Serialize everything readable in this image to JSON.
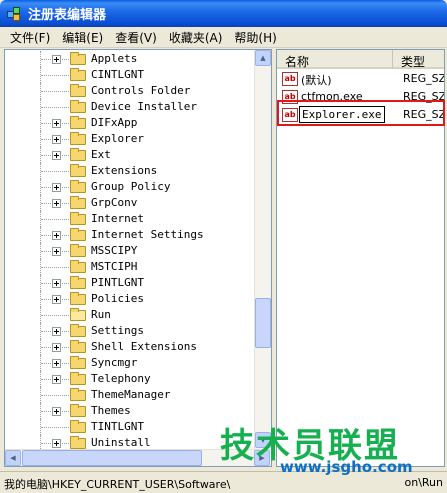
{
  "window": {
    "title": "注册表编辑器"
  },
  "menu": [
    {
      "label": "文件(F)"
    },
    {
      "label": "编辑(E)"
    },
    {
      "label": "查看(V)"
    },
    {
      "label": "收藏夹(A)"
    },
    {
      "label": "帮助(H)"
    }
  ],
  "tree": [
    {
      "label": "Applets",
      "expandable": true
    },
    {
      "label": "CINTLGNT",
      "expandable": false
    },
    {
      "label": "Controls Folder",
      "expandable": false
    },
    {
      "label": "Device Installer",
      "expandable": false
    },
    {
      "label": "DIFxApp",
      "expandable": true
    },
    {
      "label": "Explorer",
      "expandable": true
    },
    {
      "label": "Ext",
      "expandable": true
    },
    {
      "label": "Extensions",
      "expandable": false
    },
    {
      "label": "Group Policy",
      "expandable": true
    },
    {
      "label": "GrpConv",
      "expandable": true
    },
    {
      "label": "Internet",
      "expandable": false
    },
    {
      "label": "Internet Settings",
      "expandable": true
    },
    {
      "label": "MSSCIPY",
      "expandable": true
    },
    {
      "label": "MSTCIPH",
      "expandable": false
    },
    {
      "label": "PINTLGNT",
      "expandable": true
    },
    {
      "label": "Policies",
      "expandable": true
    },
    {
      "label": "Run",
      "expandable": false,
      "open": true
    },
    {
      "label": "Settings",
      "expandable": true
    },
    {
      "label": "Shell Extensions",
      "expandable": true
    },
    {
      "label": "Syncmgr",
      "expandable": true
    },
    {
      "label": "Telephony",
      "expandable": true
    },
    {
      "label": "ThemeManager",
      "expandable": false
    },
    {
      "label": "Themes",
      "expandable": true
    },
    {
      "label": "TINTLGNT",
      "expandable": false
    },
    {
      "label": "Uninstall",
      "expandable": true
    }
  ],
  "list": {
    "headers": {
      "name": "名称",
      "type": "类型"
    },
    "rows": [
      {
        "name": "(默认)",
        "type": "REG_SZ"
      },
      {
        "name": "ctfmon.exe",
        "type": "REG_SZ"
      },
      {
        "name": "Explorer.exe",
        "type": "REG_SZ",
        "editing": true
      }
    ]
  },
  "status": {
    "path": "我的电脑\\HKEY_CURRENT_USER\\Software\\",
    "path_end": "on\\Run"
  },
  "watermark": {
    "main": "技术员联盟",
    "url": "www.jsgho.com"
  },
  "colors": {
    "highlight": "#e01818",
    "title_bar": "#0a4fd4",
    "watermark_green": "#16b050",
    "watermark_blue": "#1070c0"
  },
  "icons": {
    "value": "ab-icon",
    "folder": "folder-icon"
  }
}
